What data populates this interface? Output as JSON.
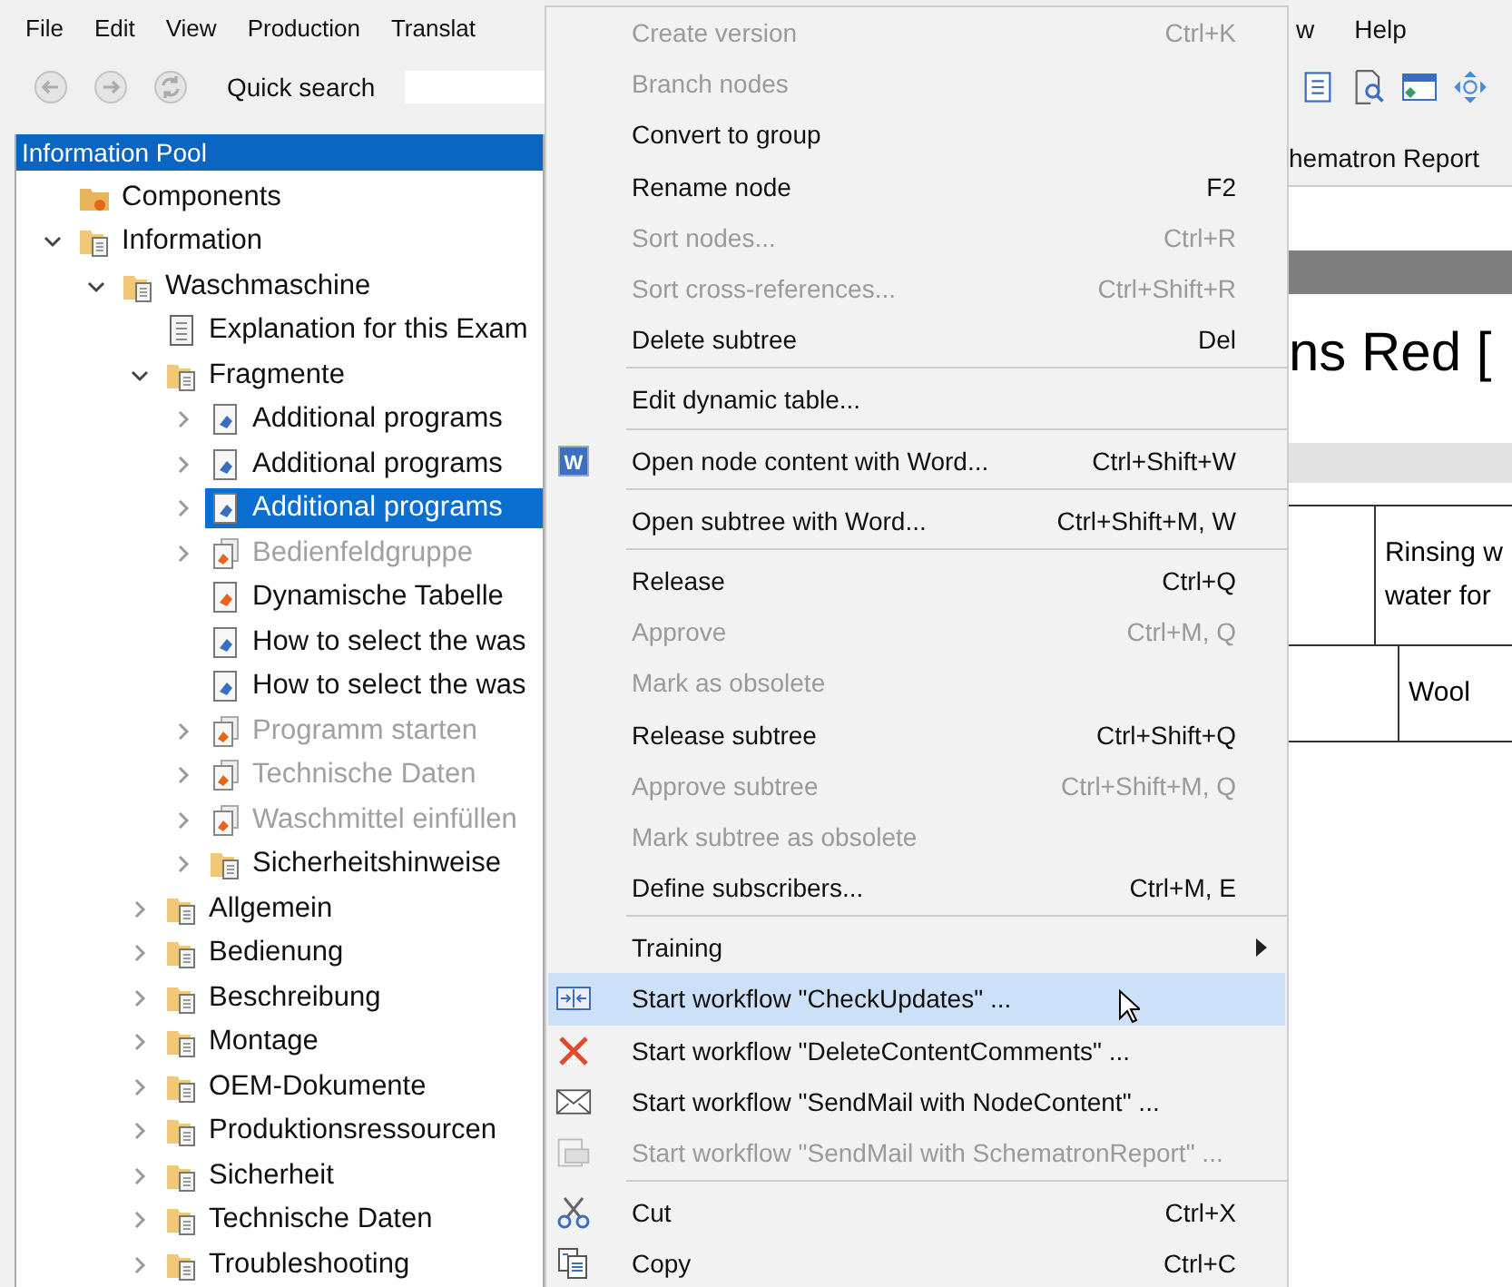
{
  "menu_bar": {
    "left_items": [
      "File",
      "Edit",
      "View",
      "Production",
      "Translat"
    ],
    "right_items": [
      "w",
      "Help"
    ]
  },
  "toolbar": {
    "nav_buttons": [
      {
        "kind": "back",
        "disabled": true
      },
      {
        "kind": "forward",
        "disabled": true
      },
      {
        "kind": "refresh",
        "disabled": true
      }
    ],
    "quick_search_label": "Quick search",
    "right_icons": [
      {
        "kind": "list"
      },
      {
        "kind": "preview"
      },
      {
        "kind": "window"
      },
      {
        "kind": "move"
      }
    ]
  },
  "information_pool": {
    "title": "Information Pool",
    "tree": [
      {
        "label": "Components",
        "kind": "component",
        "selected": false,
        "disabled": false
      },
      {
        "label": "Information",
        "kind": "folder",
        "expanded": true,
        "selected": false,
        "disabled": false,
        "children": [
          {
            "label": "Waschmaschine",
            "kind": "folder",
            "expanded": true,
            "selected": false,
            "disabled": false,
            "children": [
              {
                "label": "Explanation for this Exam",
                "kind": "document",
                "selected": false,
                "disabled": false
              },
              {
                "label": "Fragmente",
                "kind": "folder",
                "expanded": true,
                "selected": false,
                "disabled": false,
                "children": [
                  {
                    "label": "Additional programs",
                    "kind": "fragment",
                    "expanded": false,
                    "selected": false,
                    "disabled": false
                  },
                  {
                    "label": "Additional programs",
                    "kind": "fragment",
                    "expanded": false,
                    "selected": false,
                    "disabled": false
                  },
                  {
                    "label": "Additional programs",
                    "kind": "fragment",
                    "expanded": false,
                    "selected": true,
                    "disabled": false
                  },
                  {
                    "label": "Bedienfeldgruppe",
                    "kind": "variant",
                    "expanded": false,
                    "selected": false,
                    "disabled": true
                  },
                  {
                    "label": "Dynamische Tabelle",
                    "kind": "template",
                    "selected": false,
                    "disabled": false
                  },
                  {
                    "label": "How to select the was",
                    "kind": "fragment",
                    "selected": false,
                    "disabled": false
                  },
                  {
                    "label": "How to select the was",
                    "kind": "fragment",
                    "selected": false,
                    "disabled": false
                  },
                  {
                    "label": "Programm starten",
                    "kind": "variant",
                    "expanded": false,
                    "selected": false,
                    "disabled": true
                  },
                  {
                    "label": "Technische Daten",
                    "kind": "variant",
                    "expanded": false,
                    "selected": false,
                    "disabled": true
                  },
                  {
                    "label": "Waschmittel einfüllen",
                    "kind": "variant",
                    "expanded": false,
                    "selected": false,
                    "disabled": true
                  },
                  {
                    "label": "Sicherheitshinweise",
                    "kind": "folder",
                    "expanded": false,
                    "selected": false,
                    "disabled": false
                  }
                ]
              },
              {
                "label": "Allgemein",
                "kind": "folder",
                "expanded": false,
                "selected": false,
                "disabled": false
              },
              {
                "label": "Bedienung",
                "kind": "folder",
                "expanded": false,
                "selected": false,
                "disabled": false
              },
              {
                "label": "Beschreibung",
                "kind": "folder",
                "expanded": false,
                "selected": false,
                "disabled": false
              },
              {
                "label": "Montage",
                "kind": "folder",
                "expanded": false,
                "selected": false,
                "disabled": false
              },
              {
                "label": "OEM-Dokumente",
                "kind": "folder",
                "expanded": false,
                "selected": false,
                "disabled": false
              },
              {
                "label": "Produktionsressourcen",
                "kind": "folder",
                "expanded": false,
                "selected": false,
                "disabled": false
              },
              {
                "label": "Sicherheit",
                "kind": "folder",
                "expanded": false,
                "selected": false,
                "disabled": false
              },
              {
                "label": "Technische Daten",
                "kind": "folder",
                "expanded": false,
                "selected": false,
                "disabled": false
              },
              {
                "label": "Troubleshooting",
                "kind": "folder",
                "expanded": false,
                "selected": false,
                "disabled": false
              }
            ]
          }
        ]
      }
    ]
  },
  "document_view": {
    "tab_label": "hematron Report",
    "heading": "ns Red [",
    "table_rows": [
      {
        "cells": [
          [],
          [
            "Rinsing w",
            "water for"
          ]
        ]
      },
      {
        "cells": [
          [],
          [
            "Wool"
          ]
        ]
      }
    ]
  },
  "context_menu": {
    "groups": [
      [
        {
          "label": "Create version",
          "shortcut": "Ctrl+K",
          "disabled": true,
          "selected": false
        },
        {
          "label": "Branch nodes",
          "disabled": true,
          "selected": false
        },
        {
          "label": "Convert to group",
          "disabled": false,
          "selected": false
        },
        {
          "label": "Rename node",
          "shortcut": "F2",
          "disabled": false,
          "selected": false
        },
        {
          "label": "Sort nodes...",
          "shortcut": "Ctrl+R",
          "disabled": true,
          "selected": false
        },
        {
          "label": "Sort cross-references...",
          "shortcut": "Ctrl+Shift+R",
          "disabled": true,
          "selected": false
        },
        {
          "label": "Delete subtree",
          "shortcut": "Del",
          "disabled": false,
          "selected": false
        }
      ],
      [
        {
          "label": "Edit dynamic table...",
          "disabled": false,
          "selected": false
        }
      ],
      [
        {
          "label": "Open node content with Word...",
          "shortcut": "Ctrl+Shift+W",
          "kind": "word",
          "icon_text": "W",
          "disabled": false,
          "selected": false
        }
      ],
      [
        {
          "label": "Open subtree with Word...",
          "shortcut": "Ctrl+Shift+M, W",
          "disabled": false,
          "selected": false
        }
      ],
      [
        {
          "label": "Release",
          "shortcut": "Ctrl+Q",
          "disabled": false,
          "selected": false
        },
        {
          "label": "Approve",
          "shortcut": "Ctrl+M, Q",
          "disabled": true,
          "selected": false
        },
        {
          "label": "Mark as obsolete",
          "disabled": true,
          "selected": false
        },
        {
          "label": "Release subtree",
          "shortcut": "Ctrl+Shift+Q",
          "disabled": false,
          "selected": false
        },
        {
          "label": "Approve subtree",
          "shortcut": "Ctrl+Shift+M, Q",
          "disabled": true,
          "selected": false
        },
        {
          "label": "Mark subtree as obsolete",
          "disabled": true,
          "selected": false
        },
        {
          "label": "Define subscribers...",
          "shortcut": "Ctrl+M, E",
          "disabled": false,
          "selected": false
        }
      ],
      [
        {
          "label": "Training",
          "submenu": true,
          "disabled": false,
          "selected": false
        },
        {
          "label": "Start workflow \"CheckUpdates\" ...",
          "kind": "workflow",
          "disabled": false,
          "selected": true
        },
        {
          "label": "Start workflow \"DeleteContentComments\" ...",
          "kind": "delete",
          "disabled": false,
          "selected": false
        },
        {
          "label": "Start workflow \"SendMail with NodeContent\" ...",
          "kind": "mail",
          "disabled": false,
          "selected": false
        },
        {
          "label": "Start workflow \"SendMail with SchematronReport\" ...",
          "kind": "report",
          "disabled": true,
          "selected": false
        }
      ],
      [
        {
          "label": "Cut",
          "shortcut": "Ctrl+X",
          "kind": "cut",
          "disabled": false,
          "selected": false
        },
        {
          "label": "Copy",
          "shortcut": "Ctrl+C",
          "kind": "copy",
          "disabled": false,
          "selected": false
        }
      ]
    ]
  }
}
